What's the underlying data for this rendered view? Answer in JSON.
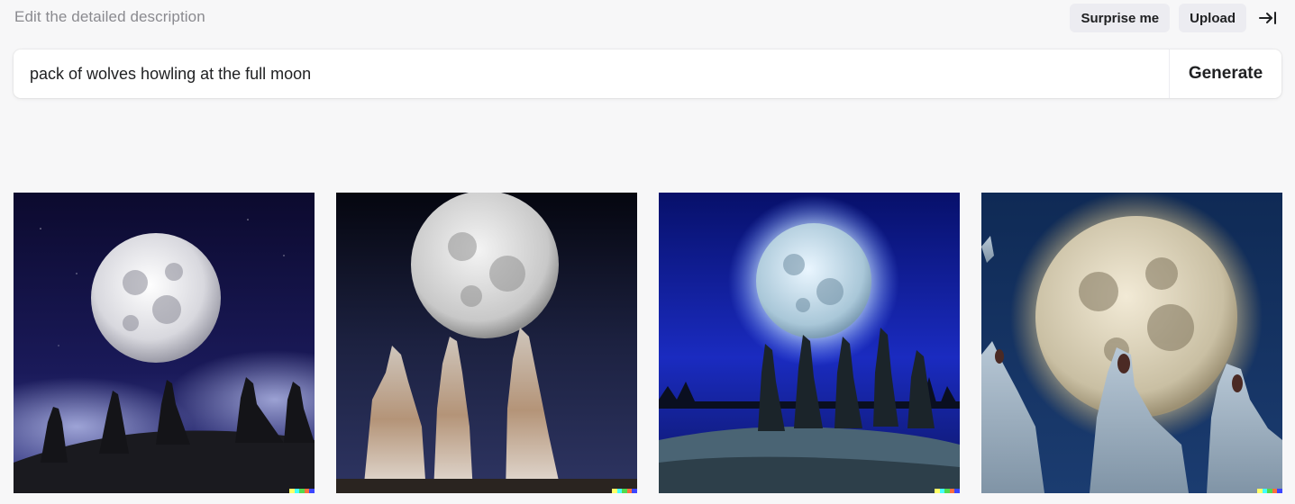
{
  "header": {
    "hint": "Edit the detailed description",
    "surprise_label": "Surprise me",
    "upload_label": "Upload"
  },
  "prompt": {
    "value": "pack of wolves howling at the full moon",
    "generate_label": "Generate"
  },
  "results": {
    "badge_colors": [
      "#ffff66",
      "#42ffff",
      "#51da4c",
      "#ff6e3c",
      "#3c46ff"
    ]
  }
}
